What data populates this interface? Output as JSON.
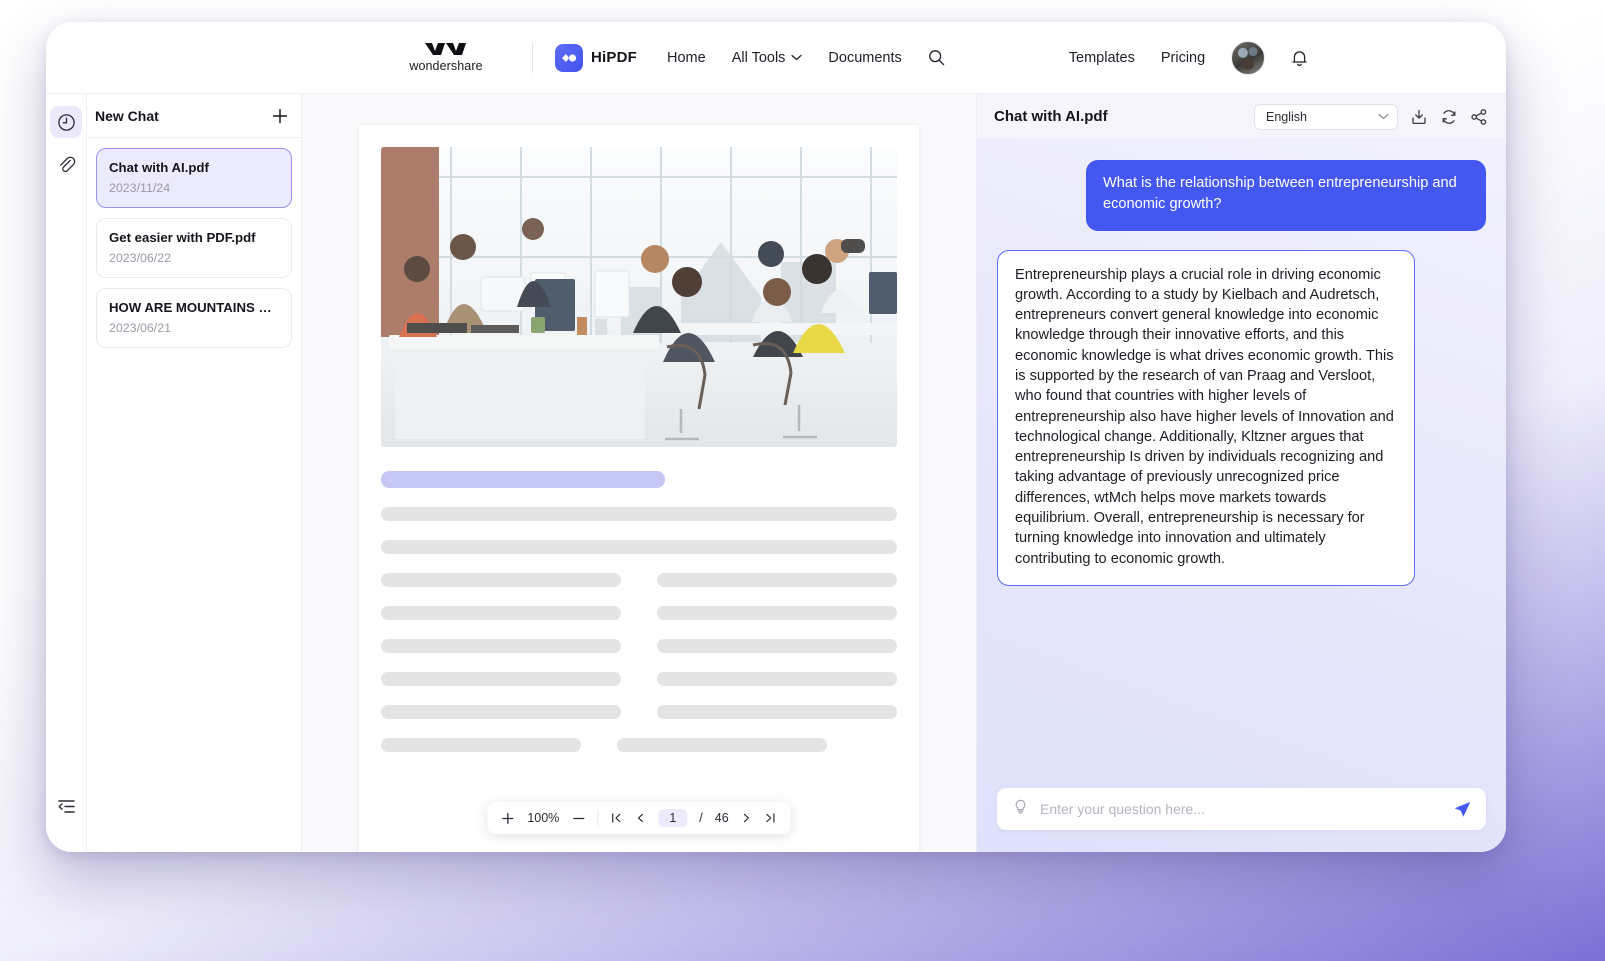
{
  "header": {
    "brand_name": "wondershare",
    "product_name": "HiPDF",
    "nav": [
      {
        "label": "Home",
        "icon": ""
      },
      {
        "label": "All Tools",
        "icon": "chevron-down-icon"
      },
      {
        "label": "Documents",
        "icon": ""
      }
    ],
    "search_icon": "search-icon",
    "right_links": [
      {
        "label": "Templates"
      },
      {
        "label": "Pricing"
      }
    ],
    "avatar": "user-avatar",
    "bell_icon": "notification-bell-icon"
  },
  "rail": {
    "items": [
      {
        "name": "history-icon",
        "active": true
      },
      {
        "name": "attachment-icon",
        "active": false
      }
    ],
    "collapse_icon": "collapse-sidebar-icon"
  },
  "sidebar": {
    "title": "New Chat",
    "add_icon": "plus-icon",
    "items": [
      {
        "name": "Chat with AI.pdf",
        "date": "2023/11/24",
        "active": true
      },
      {
        "name": "Get easier with PDF.pdf",
        "date": "2023/06/22",
        "active": false
      },
      {
        "name": "HOW ARE MOUNTAINS FOR...",
        "date": "2023/06/21",
        "active": false
      }
    ]
  },
  "viewer": {
    "toolbar": {
      "zoom_in_icon": "plus-icon",
      "zoom_level": "100%",
      "zoom_out_icon": "minus-icon",
      "first_page_icon": "first-page-icon",
      "prev_page_icon": "prev-page-icon",
      "current_page": "1",
      "page_separator": "/",
      "total_pages": "46",
      "next_page_icon": "next-page-icon",
      "last_page_icon": "last-page-icon"
    }
  },
  "chat": {
    "title": "Chat with AI.pdf",
    "language": "English",
    "language_chevron": "chevron-down-icon",
    "actions": [
      {
        "name": "download-icon"
      },
      {
        "name": "refresh-icon"
      },
      {
        "name": "share-icon"
      }
    ],
    "messages": [
      {
        "role": "user",
        "text": "What is the relationship between entrepreneurship and economic growth?"
      },
      {
        "role": "assistant",
        "text": "Entrepreneurship plays a crucial role in driving economic growth. According to a study by Kielbach and Audretsch, entrepreneurs convert general knowledge into economic knowledge through their innovative efforts, and this economic knowledge is what drives economic growth. This is supported by the research of van Praag and Versloot, who found that countries with higher levels of entrepreneurship also have higher levels of Innovation and technological change. Additionally, Kltzner argues that entrepreneurship Is driven by individuals recognizing and taking advantage of previously unrecognized price differences, wtMch helps move markets towards equilibrium. Overall, entrepreneurship is necessary for turning knowledge into innovation and ultimately contributing to economic growth."
      }
    ],
    "composer": {
      "idea_icon": "lightbulb-icon",
      "placeholder": "Enter your question here...",
      "value": "",
      "send_icon": "send-paper-plane-icon"
    }
  },
  "colors": {
    "accent": "#4457f0",
    "accent_light": "#5b6cf6",
    "sidebar_active": "#eceafd",
    "skeleton_gray": "#e4e4e4",
    "skeleton_title": "#c5c8f6"
  }
}
